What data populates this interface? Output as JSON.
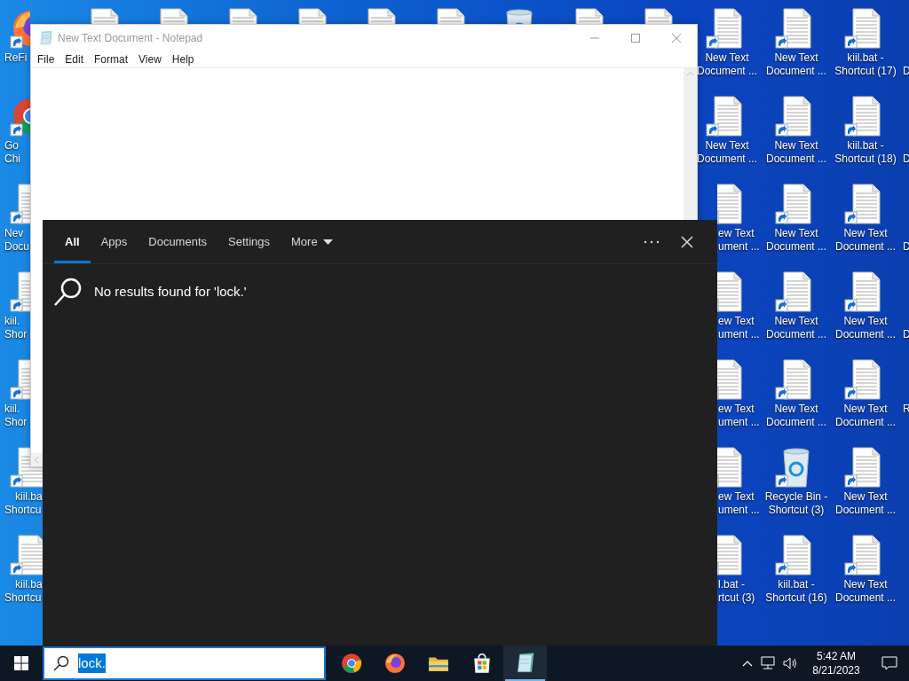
{
  "desktop": {
    "top_row_icons": [
      {
        "kind": "document"
      },
      {
        "kind": "document"
      },
      {
        "kind": "document"
      },
      {
        "kind": "document"
      },
      {
        "kind": "document"
      },
      {
        "kind": "document"
      },
      {
        "kind": "recycle"
      },
      {
        "kind": "document"
      },
      {
        "kind": "document"
      }
    ],
    "columns": [
      {
        "icons": [
          {
            "kind": "firefox",
            "line1": "ReFi"
          },
          {
            "kind": "chrome",
            "line1": "Go",
            "line2": "Chi"
          },
          {
            "kind": "document",
            "line1": "Nev",
            "line2": "Docu"
          },
          {
            "kind": "document",
            "line1": "kiil.",
            "line2": "Shor"
          },
          {
            "kind": "document",
            "line1": "kiil.",
            "line2": "Shor"
          },
          {
            "kind": "document",
            "line1": "kiil.ba",
            "line2": "Shortcu"
          },
          {
            "kind": "document",
            "line1": "kiil.ba",
            "line2": "Shortcu"
          }
        ]
      },
      {
        "icons": [
          {
            "kind": "document",
            "line1": "New Text",
            "line2": "Document ..."
          },
          {
            "kind": "document",
            "line1": "New Text",
            "line2": "Document ..."
          },
          {
            "kind": "document",
            "line1": "ew Text",
            "line2": "ument ..."
          },
          {
            "kind": "document",
            "line1": "ew Text",
            "line2": "ument ..."
          },
          {
            "kind": "document",
            "line1": "ew Text",
            "line2": "ument ..."
          },
          {
            "kind": "document",
            "line1": "ew Text",
            "line2": "ument ..."
          },
          {
            "kind": "document",
            "line1": "l.bat -",
            "line2": "rtcut (3)"
          }
        ]
      },
      {
        "icons": [
          {
            "kind": "document",
            "line1": "New Text",
            "line2": "Document ..."
          },
          {
            "kind": "document",
            "line1": "New Text",
            "line2": "Document ..."
          },
          {
            "kind": "document",
            "line1": "New Text",
            "line2": "Document ..."
          },
          {
            "kind": "document",
            "line1": "New Text",
            "line2": "Document ..."
          },
          {
            "kind": "document",
            "line1": "New Text",
            "line2": "Document ..."
          },
          {
            "kind": "recycle",
            "line1": "Recycle Bin -",
            "line2": "Shortcut (3)"
          },
          {
            "kind": "document",
            "line1": "kiil.bat -",
            "line2": "Shortcut (16)"
          }
        ]
      },
      {
        "icons": [
          {
            "kind": "document",
            "line1": "kiil.bat -",
            "line2": "Shortcut (17)"
          },
          {
            "kind": "document",
            "line1": "kiil.bat -",
            "line2": "Shortcut (18)"
          },
          {
            "kind": "document",
            "line1": "New Text",
            "line2": "Document ..."
          },
          {
            "kind": "document",
            "line1": "New Text",
            "line2": "Document ..."
          },
          {
            "kind": "document",
            "line1": "New Text",
            "line2": "Document ..."
          },
          {
            "kind": "document",
            "line1": "New Text",
            "line2": "Document ..."
          },
          {
            "kind": "document",
            "line1": "New Text",
            "line2": "Document ..."
          }
        ]
      },
      {
        "icons": [
          {
            "line2": "D"
          },
          {
            "line2": "D"
          },
          {
            "line2": "D"
          },
          {
            "line2": "D"
          },
          {
            "line1": "R"
          }
        ]
      }
    ]
  },
  "notepad": {
    "title": "New Text Document - Notepad",
    "menu": [
      "File",
      "Edit",
      "Format",
      "View",
      "Help"
    ]
  },
  "search_panel": {
    "tabs": [
      {
        "label": "All",
        "selected": true
      },
      {
        "label": "Apps",
        "selected": false
      },
      {
        "label": "Documents",
        "selected": false
      },
      {
        "label": "Settings",
        "selected": false
      },
      {
        "label": "More",
        "selected": false,
        "kind": "dropdown"
      }
    ],
    "message": "No results found for 'lock.'"
  },
  "taskbar": {
    "search": {
      "value": "lock.",
      "text_selected": true
    },
    "apps": [
      {
        "kind": "chrome",
        "active": false
      },
      {
        "kind": "firefox",
        "active": false
      },
      {
        "kind": "folder",
        "active": false
      },
      {
        "kind": "store",
        "active": false
      },
      {
        "kind": "notepad",
        "active": true
      }
    ],
    "clock": {
      "time": "5:42 AM",
      "date": "8/21/2023"
    }
  }
}
